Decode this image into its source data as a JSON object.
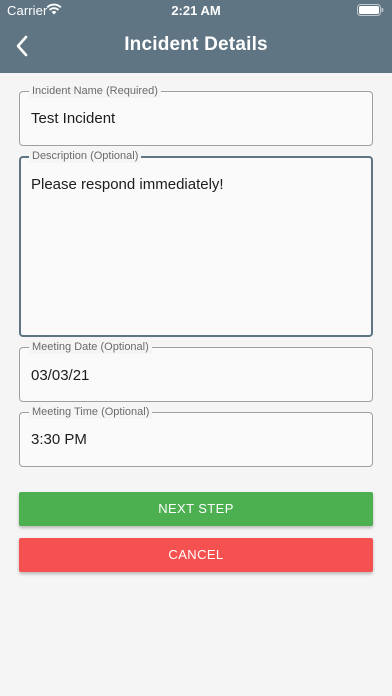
{
  "status_bar": {
    "carrier": "Carrier",
    "time": "2:21 AM"
  },
  "header": {
    "title": "Incident Details",
    "background_color": "#5f7583",
    "back_icon": "chevron-left-icon"
  },
  "form": {
    "incident_name": {
      "label": "Incident Name (Required)",
      "value": "Test Incident"
    },
    "description": {
      "label": "Description (Optional)",
      "value": "Please respond immediately!"
    },
    "meeting_date": {
      "label": "Meeting Date (Optional)",
      "value": "03/03/21"
    },
    "meeting_time": {
      "label": "Meeting Time (Optional)",
      "value": "3:30 PM"
    }
  },
  "actions": {
    "next_label": "NEXT STEP",
    "next_color": "#4caf50",
    "cancel_label": "CANCEL",
    "cancel_color": "#f55151"
  }
}
